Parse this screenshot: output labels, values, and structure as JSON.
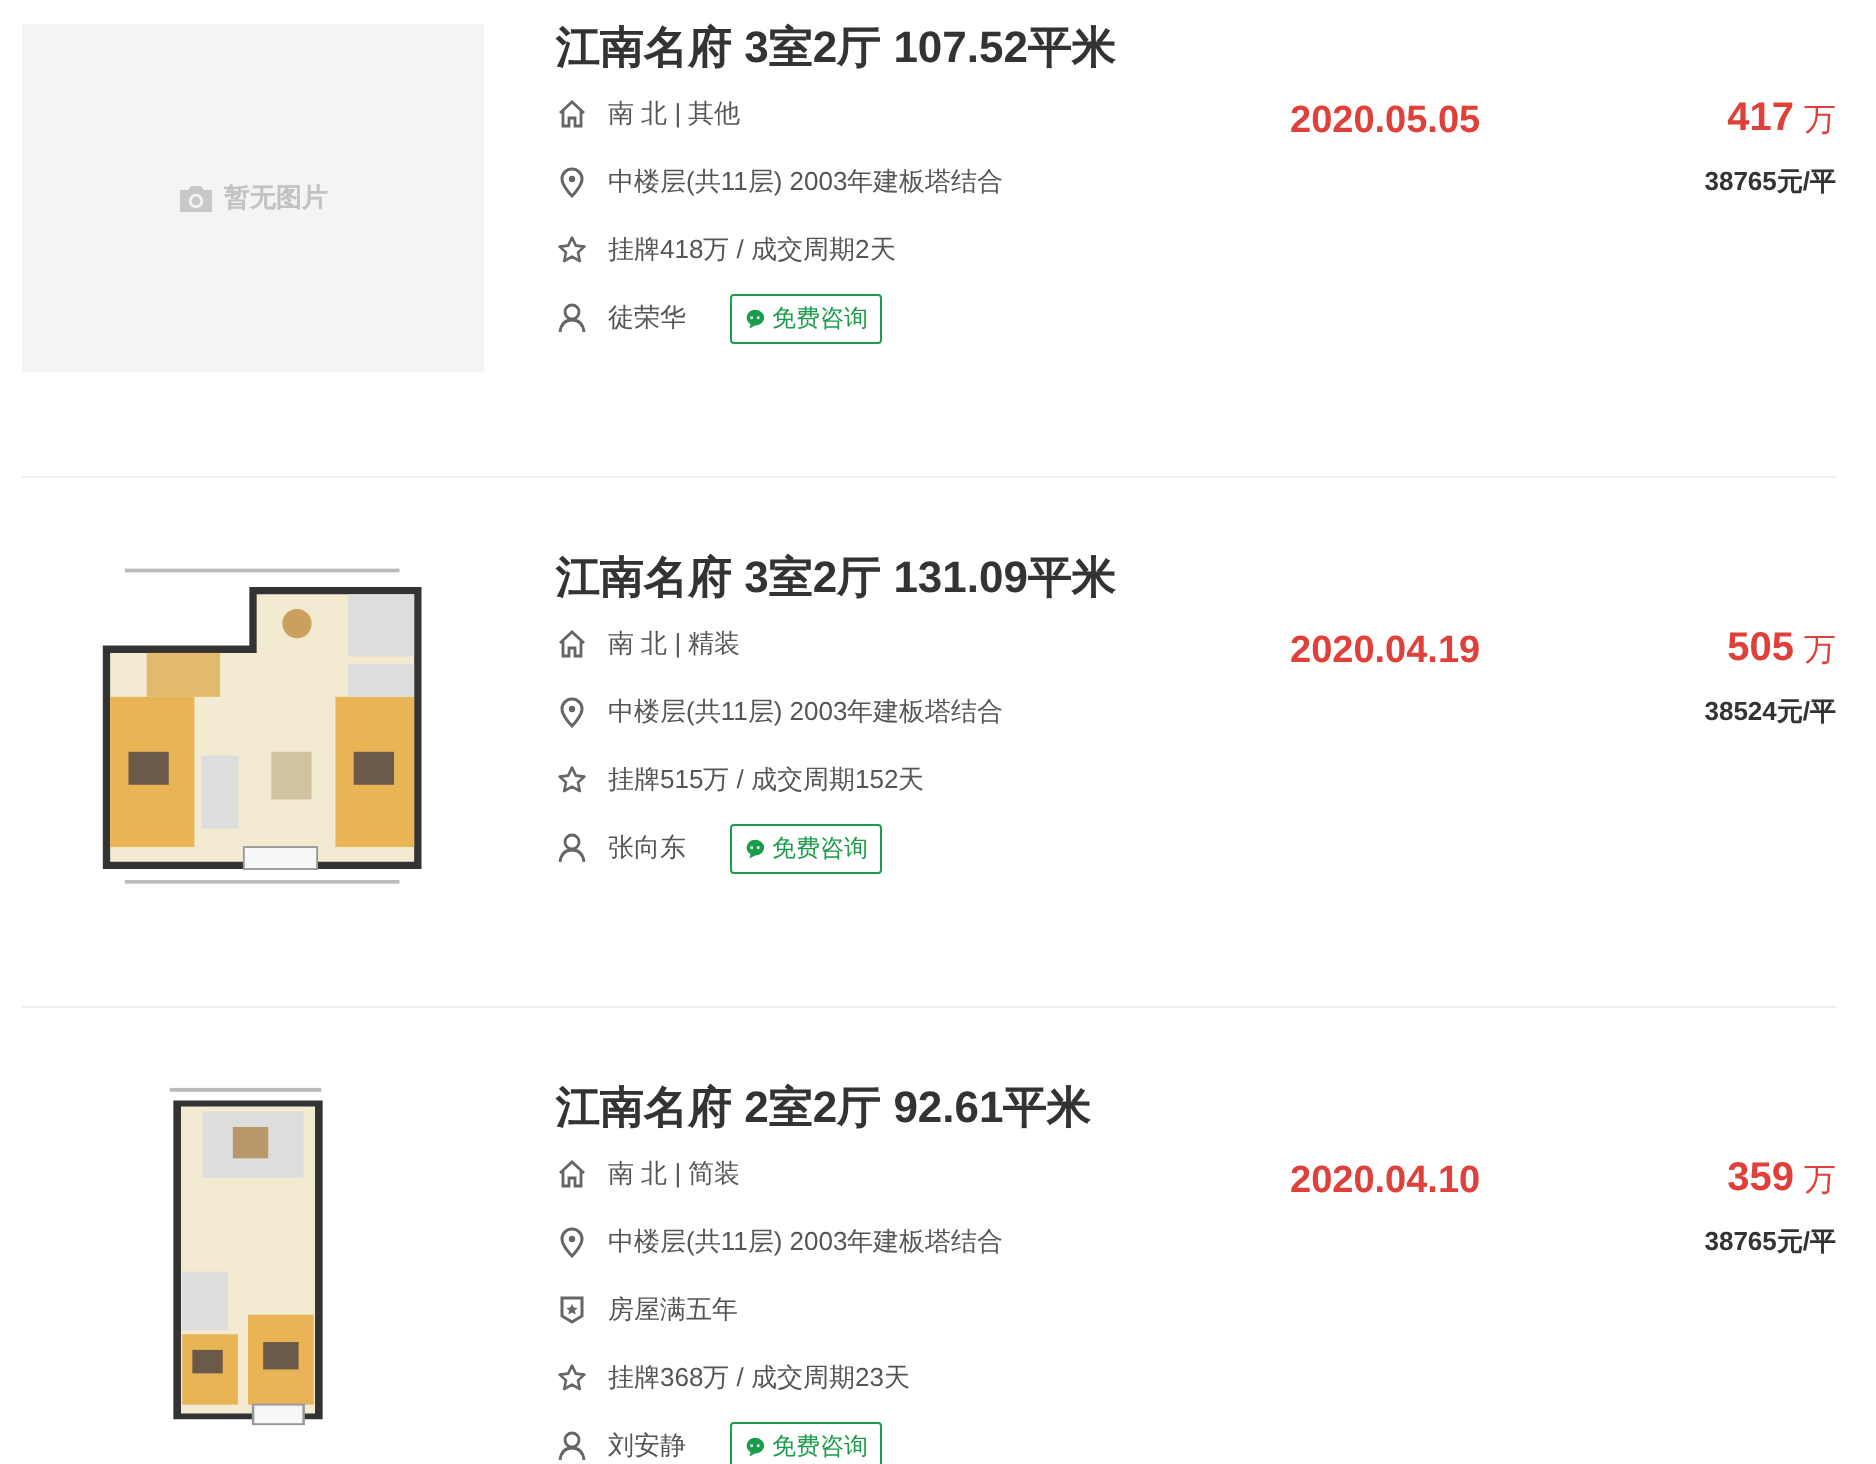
{
  "listings": [
    {
      "image": {
        "kind": "placeholder",
        "text": "暂无图片"
      },
      "title": "江南名府 3室2厅 107.52平米",
      "details": [
        {
          "kind": "orientation",
          "text": "南 北 | 其他"
        },
        {
          "kind": "floor",
          "text": "中楼层(共11层) 2003年建板塔结合"
        },
        {
          "kind": "listing",
          "text": "挂牌418万 / 成交周期2天"
        }
      ],
      "agent": "徒荣华",
      "consult_button": "免费咨询",
      "date": "2020.05.05",
      "price": "417",
      "price_unit": "万",
      "unit_price": "38765元/平"
    },
    {
      "image": {
        "kind": "picture"
      },
      "title": "江南名府 3室2厅 131.09平米",
      "details": [
        {
          "kind": "orientation",
          "text": "南 北 | 精装"
        },
        {
          "kind": "floor",
          "text": "中楼层(共11层) 2003年建板塔结合"
        },
        {
          "kind": "listing",
          "text": "挂牌515万 / 成交周期152天"
        }
      ],
      "agent": "张向东",
      "consult_button": "免费咨询",
      "date": "2020.04.19",
      "price": "505",
      "price_unit": "万",
      "unit_price": "38524元/平"
    },
    {
      "image": {
        "kind": "picture"
      },
      "title": "江南名府 2室2厅 92.61平米",
      "details": [
        {
          "kind": "orientation",
          "text": "南 北 | 简装"
        },
        {
          "kind": "floor",
          "text": "中楼层(共11层) 2003年建板塔结合"
        },
        {
          "kind": "tax",
          "text": "房屋满五年"
        },
        {
          "kind": "listing",
          "text": "挂牌368万 / 成交周期23天"
        }
      ],
      "agent": "刘安静",
      "consult_button": "免费咨询",
      "date": "2020.04.10",
      "price": "359",
      "price_unit": "万",
      "unit_price": "38765元/平"
    }
  ]
}
